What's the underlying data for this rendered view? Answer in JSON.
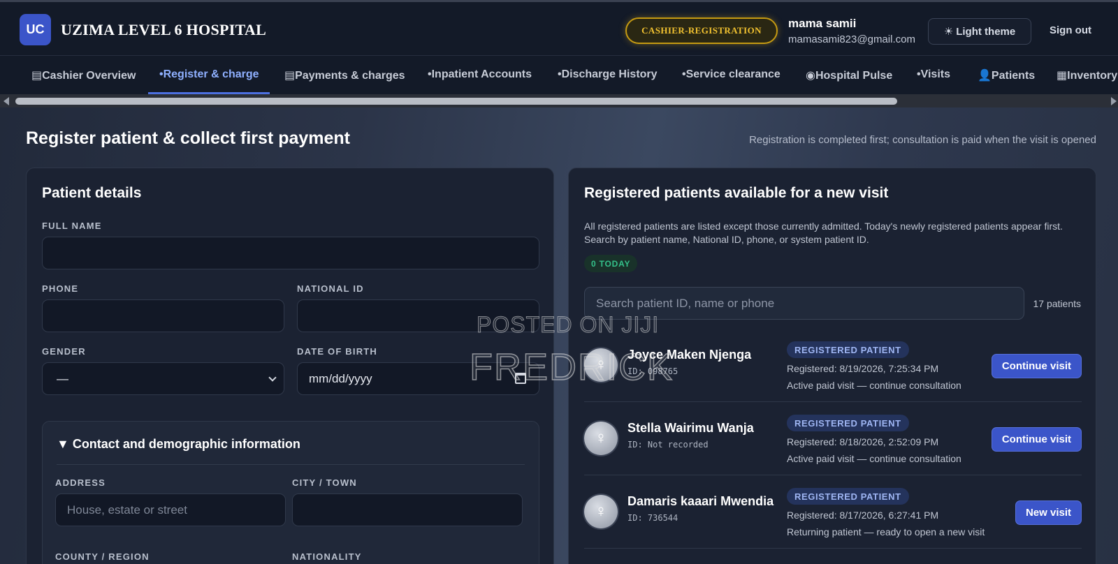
{
  "header": {
    "logo_text": "UC",
    "hospital_name": "UZIMA LEVEL 6 HOSPITAL",
    "role_badge": "CASHIER-REGISTRATION",
    "user_name": "mama samii",
    "user_email": "mamasami823@gmail.com",
    "theme_label": "Light theme",
    "theme_icon": "sun-icon",
    "signout_label": "Sign out"
  },
  "nav": {
    "tabs": [
      {
        "label": "▤Cashier Overview",
        "active": false
      },
      {
        "label": "•Register & charge",
        "active": true
      },
      {
        "label": "▤Payments & charges",
        "active": false
      },
      {
        "label": "•Inpatient Accounts",
        "active": false
      },
      {
        "label": "•Discharge History",
        "active": false
      },
      {
        "label": "•Service clearance",
        "active": false
      },
      {
        "label": "◉Hospital Pulse",
        "active": false
      },
      {
        "label": "•Visits",
        "active": false
      },
      {
        "label": "👤Patients",
        "active": false
      },
      {
        "label": "▦Inventory",
        "active": false
      }
    ]
  },
  "page": {
    "title": "Register patient & collect first payment",
    "subtitle": "Registration is completed first; consultation is paid when the visit is opened"
  },
  "patient_form": {
    "title": "Patient details",
    "full_name_label": "FULL NAME",
    "full_name_value": "",
    "phone_label": "PHONE",
    "phone_value": "",
    "national_id_label": "NATIONAL ID",
    "national_id_value": "",
    "gender_label": "GENDER",
    "gender_value": "—",
    "dob_label": "DATE OF BIRTH",
    "dob_value": "mm/dd/yyyy",
    "contact_section_title": "▼ Contact and demographic information",
    "address_label": "ADDRESS",
    "address_placeholder": "House, estate or street",
    "city_label": "CITY / TOWN",
    "city_value": "",
    "county_label": "COUNTY / REGION",
    "nationality_label": "NATIONALITY"
  },
  "registered_patients": {
    "title": "Registered patients available for a new visit",
    "description": "All registered patients are listed except those currently admitted. Today's newly registered patients appear first. Search by patient name, National ID, phone, or system patient ID.",
    "today_badge": "0 TODAY",
    "search_placeholder": "Search patient ID, name or phone",
    "count_label": "17 patients",
    "patients": [
      {
        "name": "Joyce Maken Njenga",
        "id": "ID: 098765",
        "status": "REGISTERED PATIENT",
        "registered": "Registered: 8/19/2026, 7:25:34 PM",
        "note": "Active paid visit — continue consultation",
        "action": "Continue visit",
        "avatar_icon": "female-icon"
      },
      {
        "name": "Stella Wairimu Wanja",
        "id": "ID: Not recorded",
        "status": "REGISTERED PATIENT",
        "registered": "Registered: 8/18/2026, 2:52:09 PM",
        "note": "Active paid visit — continue consultation",
        "action": "Continue visit",
        "avatar_icon": "female-icon"
      },
      {
        "name": "Damaris kaaari Mwendia",
        "id": "ID: 736544",
        "status": "REGISTERED PATIENT",
        "registered": "Registered: 8/17/2026, 6:27:41 PM",
        "note": "Returning patient — ready to open a new visit",
        "action": "New visit",
        "avatar_icon": "female-icon"
      }
    ]
  },
  "watermark": {
    "line1": "POSTED ON JIJI",
    "line2": "FREDRICK"
  }
}
